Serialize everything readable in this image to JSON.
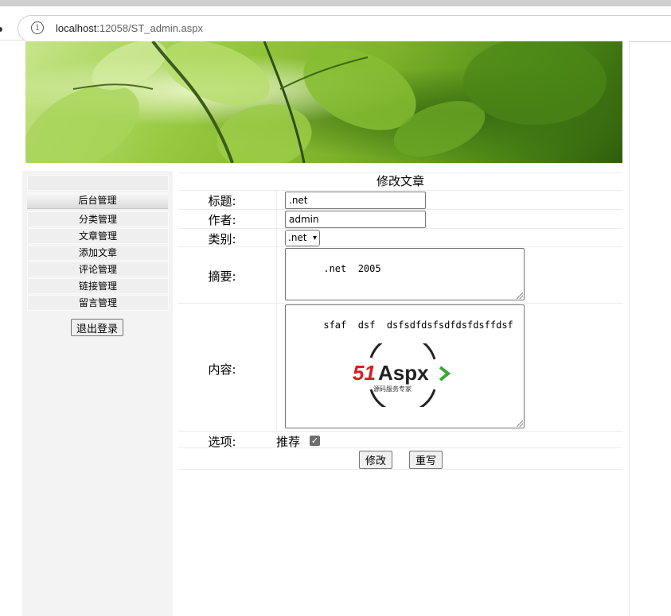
{
  "browser": {
    "url_host": "localhost",
    "url_rest": ":12058/ST_admin.aspx"
  },
  "sidebar": {
    "header": "后台管理",
    "items": [
      {
        "label": "分类管理"
      },
      {
        "label": "文章管理"
      },
      {
        "label": "添加文章"
      },
      {
        "label": "评论管理"
      },
      {
        "label": "链接管理"
      },
      {
        "label": "留言管理"
      }
    ],
    "logout_label": "退出登录"
  },
  "form": {
    "title": "修改文章",
    "title_label": "标题:",
    "title_value": ".net",
    "author_label": "作者:",
    "author_value": "admin",
    "category_label": "类别:",
    "category_value": ".net",
    "summary_label": "摘要:",
    "summary_value": ".net  2005",
    "content_label": "内容:",
    "content_value": "sfaf  dsf  dsfsdfdsfsdfdsfdsffdsf",
    "content_image": {
      "logo_text": "51Aspx",
      "logo_subtext": "源码服务专家"
    },
    "options_label": "选项:",
    "recommend_label": "推荐",
    "recommend_checked": true,
    "submit_label": "修改",
    "reset_label": "重写"
  }
}
